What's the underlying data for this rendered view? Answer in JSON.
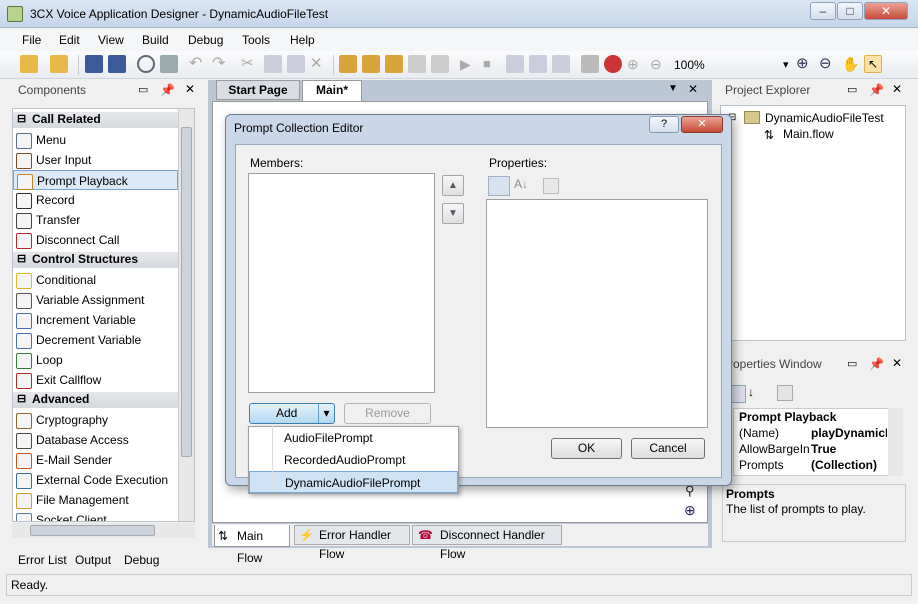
{
  "window": {
    "title": "3CX Voice Application Designer - DynamicAudioFileTest",
    "min": "–",
    "max": "□",
    "close": "✕"
  },
  "menu": [
    "File",
    "Edit",
    "View",
    "Build",
    "Debug",
    "Tools",
    "Help"
  ],
  "toolbar": {
    "zoom": "100%",
    "zoom_arrow": "▾"
  },
  "components": {
    "title": "Components",
    "categories": [
      {
        "label": "Call Related",
        "items": [
          "Menu",
          "User Input",
          "Prompt Playback",
          "Record",
          "Transfer",
          "Disconnect Call"
        ]
      },
      {
        "label": "Control Structures",
        "items": [
          "Conditional",
          "Variable Assignment",
          "Increment Variable",
          "Decrement Variable",
          "Loop",
          "Exit Callflow"
        ]
      },
      {
        "label": "Advanced",
        "items": [
          "Cryptography",
          "Database Access",
          "E-Mail Sender",
          "External Code Execution",
          "File Management",
          "Socket Client"
        ]
      }
    ],
    "selected": "Prompt Playback"
  },
  "doc_tabs": {
    "start": "Start Page",
    "main": "Main*"
  },
  "flow_tabs": {
    "main": "Main Flow",
    "error": "Error Handler Flow",
    "disconnect": "Disconnect Handler Flow"
  },
  "project_explorer": {
    "title": "Project Explorer",
    "project": "DynamicAudioFileTest",
    "file": "Main.flow"
  },
  "properties_window": {
    "title": "roperties Window",
    "header": "Prompt  Playback",
    "rows": [
      {
        "name": "(Name)",
        "value": "playDynamicF"
      },
      {
        "name": "AllowBargeIn",
        "value": "True"
      },
      {
        "name": "Prompts",
        "value": "(Collection)"
      }
    ],
    "desc_title": "Prompts",
    "desc_text": "The list of prompts to play."
  },
  "dialog": {
    "title": "Prompt Collection Editor",
    "help": "?",
    "close": "✕",
    "members_label": "Members:",
    "properties_label": "Properties:",
    "add_label": "Add",
    "add_arrow": "▾",
    "remove_label": "Remove",
    "ok_label": "OK",
    "cancel_label": "Cancel",
    "dropdown": [
      "AudioFilePrompt",
      "RecordedAudioPrompt",
      "DynamicAudioFilePrompt"
    ],
    "dropdown_selected": "DynamicAudioFilePrompt"
  },
  "bottom_tabs": [
    "Error List",
    "Output",
    "Debug"
  ],
  "status": "Ready."
}
